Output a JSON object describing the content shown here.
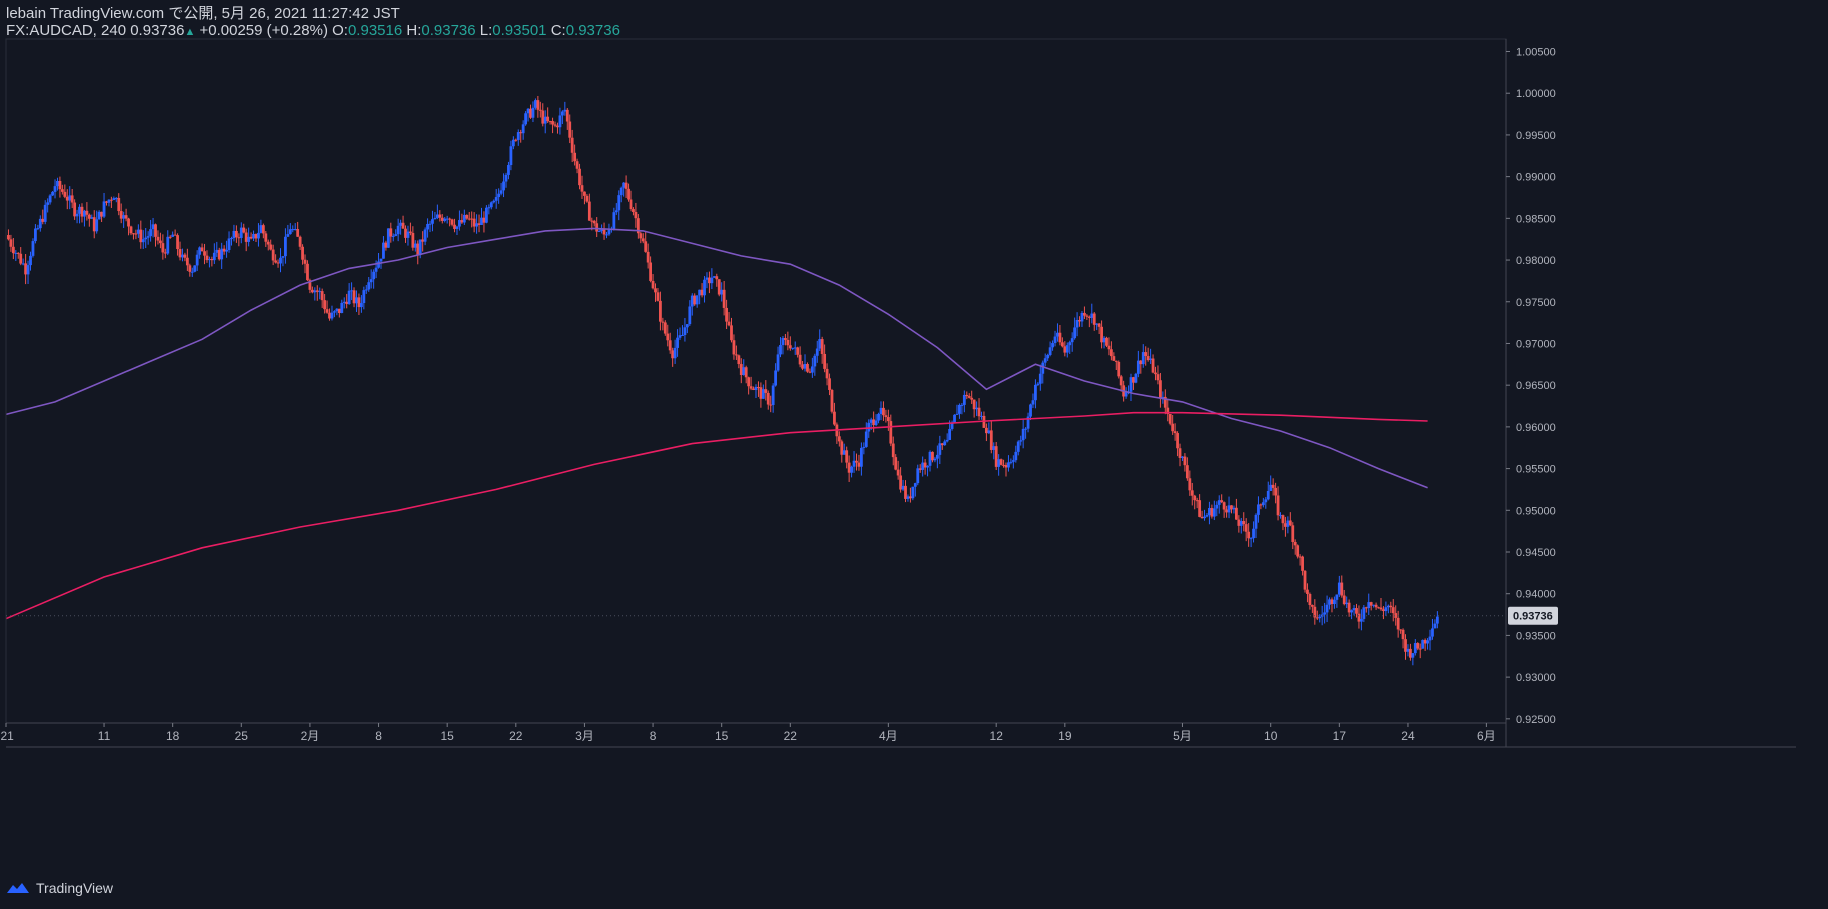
{
  "header": {
    "publisher": "lebain TradingView.com で公開, 5月 26, 2021 11:27:42 JST",
    "symbol": "FX:AUDCAD, 240",
    "last": "0.93736",
    "change": "+0.00259 (+0.28%)",
    "o_label": "O:",
    "o_value": "0.93516",
    "h_label": "H:",
    "h_value": "0.93736",
    "l_label": "L:",
    "l_value": "0.93501",
    "c_label": "C:",
    "c_value": "0.93736"
  },
  "footer": {
    "brand": "TradingView"
  },
  "colors": {
    "background": "#131722",
    "up": "#2962ff",
    "down": "#ef5350",
    "ma_short": "#7e57c2",
    "ma_long": "#e91e63",
    "positive": "#26a69a"
  },
  "chart_data": {
    "type": "candlestick",
    "symbol": "FX:AUDCAD",
    "interval": "240",
    "ylim": [
      0.9245,
      1.0065
    ],
    "y_ticks": [
      "1.00500",
      "1.00000",
      "0.99500",
      "0.99000",
      "0.98500",
      "0.98000",
      "0.97500",
      "0.97000",
      "0.96500",
      "0.96000",
      "0.95500",
      "0.95000",
      "0.94500",
      "0.94000",
      "0.93500",
      "0.93000",
      "0.92500"
    ],
    "x_ticks": [
      {
        "label": "'21",
        "d": 0
      },
      {
        "label": "11",
        "d": 10
      },
      {
        "label": "18",
        "d": 17
      },
      {
        "label": "25",
        "d": 24
      },
      {
        "label": "2月",
        "d": 31
      },
      {
        "label": "8",
        "d": 38
      },
      {
        "label": "15",
        "d": 45
      },
      {
        "label": "22",
        "d": 52
      },
      {
        "label": "3月",
        "d": 59
      },
      {
        "label": "8",
        "d": 66
      },
      {
        "label": "15",
        "d": 73
      },
      {
        "label": "22",
        "d": 80
      },
      {
        "label": "4月",
        "d": 90
      },
      {
        "label": "12",
        "d": 101
      },
      {
        "label": "19",
        "d": 108
      },
      {
        "label": "5月",
        "d": 120
      },
      {
        "label": "10",
        "d": 129
      },
      {
        "label": "17",
        "d": 136
      },
      {
        "label": "24",
        "d": 143
      },
      {
        "label": "6月",
        "d": 151
      }
    ],
    "x_range": [
      0,
      153
    ],
    "last_price": "0.93736",
    "price_path": [
      [
        0,
        0.983
      ],
      [
        1,
        0.981
      ],
      [
        2,
        0.979
      ],
      [
        3,
        0.983
      ],
      [
        4,
        0.986
      ],
      [
        5,
        0.989
      ],
      [
        6,
        0.988
      ],
      [
        7,
        0.986
      ],
      [
        8,
        0.986
      ],
      [
        9,
        0.984
      ],
      [
        10,
        0.9865
      ],
      [
        11,
        0.988
      ],
      [
        12,
        0.985
      ],
      [
        13,
        0.9835
      ],
      [
        14,
        0.9825
      ],
      [
        15,
        0.9835
      ],
      [
        16,
        0.981
      ],
      [
        17,
        0.983
      ],
      [
        18,
        0.98
      ],
      [
        19,
        0.979
      ],
      [
        20,
        0.9815
      ],
      [
        21,
        0.98
      ],
      [
        22,
        0.981
      ],
      [
        23,
        0.9825
      ],
      [
        24,
        0.9835
      ],
      [
        25,
        0.982
      ],
      [
        26,
        0.984
      ],
      [
        27,
        0.981
      ],
      [
        28,
        0.98
      ],
      [
        29,
        0.984
      ],
      [
        30,
        0.982
      ],
      [
        31,
        0.977
      ],
      [
        32,
        0.976
      ],
      [
        33,
        0.973
      ],
      [
        34,
        0.974
      ],
      [
        35,
        0.976
      ],
      [
        36,
        0.9745
      ],
      [
        37,
        0.978
      ],
      [
        38,
        0.98
      ],
      [
        39,
        0.983
      ],
      [
        40,
        0.984
      ],
      [
        41,
        0.983
      ],
      [
        42,
        0.981
      ],
      [
        43,
        0.984
      ],
      [
        44,
        0.985
      ],
      [
        45,
        0.9855
      ],
      [
        46,
        0.984
      ],
      [
        47,
        0.985
      ],
      [
        48,
        0.984
      ],
      [
        49,
        0.9855
      ],
      [
        50,
        0.987
      ],
      [
        51,
        0.991
      ],
      [
        52,
        0.995
      ],
      [
        53,
        0.997
      ],
      [
        54,
        0.9985
      ],
      [
        55,
        0.9965
      ],
      [
        56,
        0.996
      ],
      [
        57,
        0.998
      ],
      [
        58,
        0.992
      ],
      [
        59,
        0.987
      ],
      [
        60,
        0.984
      ],
      [
        61,
        0.983
      ],
      [
        62,
        0.985
      ],
      [
        63,
        0.989
      ],
      [
        64,
        0.986
      ],
      [
        65,
        0.982
      ],
      [
        66,
        0.977
      ],
      [
        67,
        0.972
      ],
      [
        68,
        0.969
      ],
      [
        69,
        0.971
      ],
      [
        70,
        0.975
      ],
      [
        71,
        0.9765
      ],
      [
        72,
        0.978
      ],
      [
        73,
        0.976
      ],
      [
        74,
        0.97
      ],
      [
        75,
        0.967
      ],
      [
        76,
        0.965
      ],
      [
        77,
        0.964
      ],
      [
        78,
        0.963
      ],
      [
        79,
        0.97
      ],
      [
        80,
        0.97
      ],
      [
        81,
        0.968
      ],
      [
        82,
        0.967
      ],
      [
        83,
        0.97
      ],
      [
        84,
        0.964
      ],
      [
        85,
        0.958
      ],
      [
        86,
        0.955
      ],
      [
        87,
        0.956
      ],
      [
        88,
        0.96
      ],
      [
        89,
        0.962
      ],
      [
        90,
        0.96
      ],
      [
        91,
        0.954
      ],
      [
        92,
        0.951
      ],
      [
        93,
        0.955
      ],
      [
        94,
        0.956
      ],
      [
        95,
        0.957
      ],
      [
        96,
        0.958
      ],
      [
        97,
        0.962
      ],
      [
        98,
        0.964
      ],
      [
        99,
        0.962
      ],
      [
        100,
        0.96
      ],
      [
        101,
        0.956
      ],
      [
        102,
        0.9555
      ],
      [
        103,
        0.957
      ],
      [
        104,
        0.96
      ],
      [
        105,
        0.965
      ],
      [
        106,
        0.968
      ],
      [
        107,
        0.971
      ],
      [
        108,
        0.969
      ],
      [
        109,
        0.972
      ],
      [
        110,
        0.974
      ],
      [
        111,
        0.973
      ],
      [
        112,
        0.97
      ],
      [
        113,
        0.968
      ],
      [
        114,
        0.964
      ],
      [
        115,
        0.966
      ],
      [
        116,
        0.969
      ],
      [
        117,
        0.967
      ],
      [
        118,
        0.963
      ],
      [
        119,
        0.96
      ],
      [
        120,
        0.956
      ],
      [
        121,
        0.952
      ],
      [
        122,
        0.949
      ],
      [
        123,
        0.95
      ],
      [
        124,
        0.951
      ],
      [
        125,
        0.95
      ],
      [
        126,
        0.948
      ],
      [
        127,
        0.947
      ],
      [
        128,
        0.951
      ],
      [
        129,
        0.953
      ],
      [
        130,
        0.949
      ],
      [
        131,
        0.948
      ],
      [
        132,
        0.944
      ],
      [
        133,
        0.938
      ],
      [
        134,
        0.937
      ],
      [
        135,
        0.939
      ],
      [
        136,
        0.941
      ],
      [
        137,
        0.938
      ],
      [
        138,
        0.937
      ],
      [
        139,
        0.9395
      ],
      [
        140,
        0.938
      ],
      [
        141,
        0.9385
      ],
      [
        142,
        0.936
      ],
      [
        143,
        0.933
      ],
      [
        144,
        0.9335
      ],
      [
        145,
        0.935
      ],
      [
        146,
        0.93736
      ]
    ],
    "series": [
      {
        "name": "",
        "type": "line",
        "color": "#7e57c2",
        "points": [
          [
            0,
            0.9615
          ],
          [
            5,
            0.963
          ],
          [
            10,
            0.9655
          ],
          [
            15,
            0.968
          ],
          [
            20,
            0.9705
          ],
          [
            25,
            0.974
          ],
          [
            30,
            0.977
          ],
          [
            35,
            0.979
          ],
          [
            40,
            0.98
          ],
          [
            45,
            0.9815
          ],
          [
            50,
            0.9825
          ],
          [
            55,
            0.9835
          ],
          [
            60,
            0.9838
          ],
          [
            65,
            0.9835
          ],
          [
            70,
            0.982
          ],
          [
            75,
            0.9805
          ],
          [
            80,
            0.9795
          ],
          [
            85,
            0.977
          ],
          [
            90,
            0.9735
          ],
          [
            95,
            0.9695
          ],
          [
            100,
            0.9645
          ],
          [
            105,
            0.9675
          ],
          [
            110,
            0.9655
          ],
          [
            115,
            0.964
          ],
          [
            120,
            0.963
          ],
          [
            125,
            0.961
          ],
          [
            130,
            0.9595
          ],
          [
            135,
            0.9575
          ],
          [
            140,
            0.955
          ],
          [
            145,
            0.9527
          ]
        ]
      },
      {
        "name": "",
        "type": "line",
        "color": "#e91e63",
        "points": [
          [
            0,
            0.937
          ],
          [
            10,
            0.942
          ],
          [
            20,
            0.9455
          ],
          [
            30,
            0.948
          ],
          [
            40,
            0.95
          ],
          [
            50,
            0.9525
          ],
          [
            60,
            0.9555
          ],
          [
            70,
            0.958
          ],
          [
            80,
            0.9593
          ],
          [
            90,
            0.96
          ],
          [
            100,
            0.9607
          ],
          [
            110,
            0.9613
          ],
          [
            115,
            0.9617
          ],
          [
            120,
            0.9617
          ],
          [
            130,
            0.9614
          ],
          [
            140,
            0.9609
          ],
          [
            145,
            0.9607
          ]
        ]
      }
    ]
  }
}
